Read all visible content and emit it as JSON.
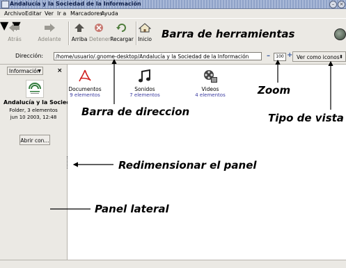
{
  "window": {
    "title": "Andalucía y la Sociedad de la Información"
  },
  "menu": [
    "Archivo",
    "Editar",
    "Ver",
    "Ir a",
    "Marcadores",
    "Ayuda"
  ],
  "toolbar": {
    "back": "Atrás",
    "forward": "Adelante",
    "up": "Arriba",
    "stop": "Detener",
    "reload": "Recargar",
    "home": "Inicio"
  },
  "location": {
    "label": "Dirección:",
    "value": "/home/usuario/.gnome-desktop/Andalucía y la Sociedad de la Información",
    "zoom": "100",
    "view_mode": "Ver como iconos"
  },
  "sidepanel": {
    "selector": "Información",
    "title": "Andalucía y la Socied",
    "meta1": "Folder, 3 elementos",
    "meta2": "jun 10 2003, 12:48",
    "open_button": "Abrir con..."
  },
  "files": [
    {
      "name": "Documentos",
      "count": "9 elementos"
    },
    {
      "name": "Sonidos",
      "count": "7 elementos"
    },
    {
      "name": "Videos",
      "count": "4 elementos"
    }
  ],
  "annotations": {
    "toolbar": "Barra de herramientas",
    "zoom": "Zoom",
    "address": "Barra de direccion",
    "view": "Tipo de vista",
    "resize": "Redimensionar el panel",
    "sidepanel": "Panel lateral"
  }
}
